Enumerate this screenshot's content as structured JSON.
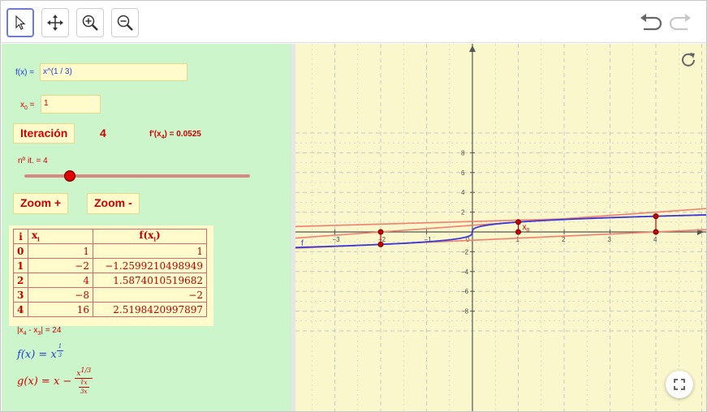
{
  "toolbar": {
    "tools": [
      {
        "name": "move-tool",
        "icon": "pointer-icon"
      },
      {
        "name": "move-graphics-view-tool",
        "icon": "move-arrows-icon"
      },
      {
        "name": "zoom-in-tool",
        "icon": "zoom-in-icon"
      },
      {
        "name": "zoom-out-tool",
        "icon": "zoom-out-icon"
      }
    ],
    "undo_icon": "undo-icon",
    "redo_icon": "redo-icon"
  },
  "algebra": {
    "f_label": "f(x) = ",
    "f_value": "x^(1 / 3)",
    "x0_label": "x",
    "x0_sub": "0",
    "x0_eq": " = ",
    "x0_value": "1",
    "iteration_button": "Iteración",
    "iteration_count": "4",
    "derivative_prefix": "f'(x",
    "derivative_sub": "4",
    "derivative_suffix": ") = 0.0525",
    "slider_label": "nº it. = 4",
    "slider_value": 4,
    "slider_min": 0,
    "slider_max": 20,
    "zoom_in_button": "Zoom +",
    "zoom_out_button": "Zoom -",
    "table": {
      "headers": [
        "i",
        "x",
        "f(x"
      ],
      "header_sub": "i",
      "rows": [
        [
          "0",
          "1",
          "1"
        ],
        [
          "1",
          "−2",
          "−1.2599210498949"
        ],
        [
          "2",
          "4",
          "1.5874010519682"
        ],
        [
          "3",
          "−8",
          "−2"
        ],
        [
          "4",
          "16",
          "2.5198420997897"
        ]
      ]
    },
    "diff_prefix": "|x",
    "diff_sub1": "4",
    "diff_mid": " - x",
    "diff_sub2": "3",
    "diff_suffix": "| = 24",
    "formula_f_lhs": "f(x) = x",
    "formula_f_exp_num": "1",
    "formula_f_exp_den": "3",
    "formula_g_lhs": "g(x) = x −",
    "formula_g_num": "x",
    "formula_g_num_exp": "1/3",
    "formula_g_den_top": "∛x",
    "formula_g_den_bot": "3x"
  },
  "graphics": {
    "refresh_icon": "refresh-icon",
    "fullscreen_icon": "fullscreen-icon",
    "function_label": "f",
    "point_label": "x",
    "point_label_sub": "0",
    "x_ticks": [
      "−3",
      "−2",
      "−1",
      "0",
      "1",
      "2",
      "3",
      "4"
    ],
    "y_ticks": [
      "8",
      "6",
      "4",
      "2",
      "−2",
      "−4",
      "−6",
      "−8"
    ],
    "colors": {
      "curve": "#3a3ad8",
      "tangent": "#f08070",
      "point": "#cc0000",
      "grid": "#c8c8c8"
    }
  }
}
